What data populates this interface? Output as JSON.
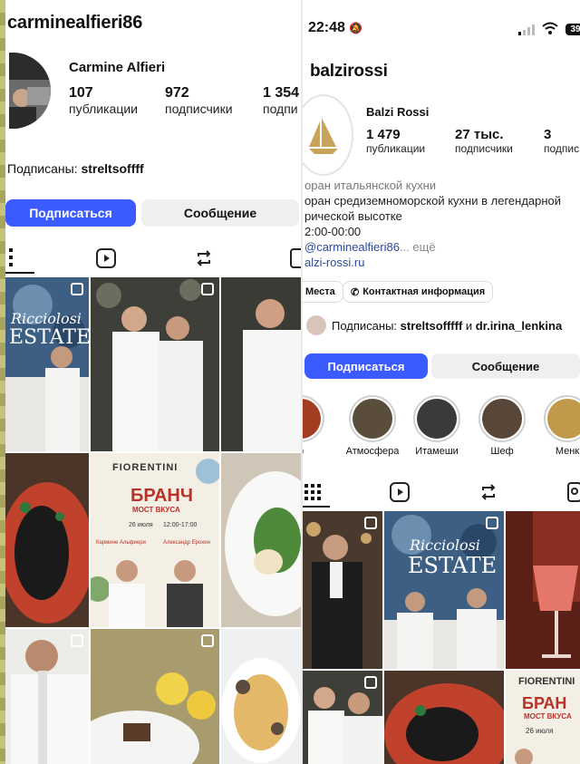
{
  "left": {
    "username": "carminealfieri86",
    "full_name": "Carmine Alfieri",
    "stats": [
      {
        "num": "107",
        "label": "публикации"
      },
      {
        "num": "972",
        "label": "подписчики"
      },
      {
        "num": "1 354",
        "label": "подпи"
      }
    ],
    "followed_by_prefix": "Подписаны:",
    "followed_by_user": "streltsoffff",
    "follow_btn": "Подписаться",
    "message_btn": "Сообщение",
    "grid_tile_texts": {
      "estate_title": "Ricciolosi",
      "estate_sub": "ESTATE",
      "brand": "FIORENTINI",
      "brunch": "БРАНЧ",
      "brunch_sub": "МОСТ ВКУСА",
      "date": "26 июля",
      "time": "12:00-17:00",
      "chef1": "Кармине Альфиери",
      "chef2": "Александр Ерохин"
    }
  },
  "right": {
    "status_time": "22:48",
    "battery": "39",
    "username": "balzirossi",
    "full_name": "Balzi Rossi",
    "stats": [
      {
        "num": "1 479",
        "label": "публикации"
      },
      {
        "num": "27 тыс.",
        "label": "подписчики"
      },
      {
        "num": "3",
        "label": "подпис"
      }
    ],
    "bio_lines": [
      "оран итальянской кухни",
      "оран средиземноморской кухни в легендарной",
      "рической высотке",
      "2:00-00:00"
    ],
    "mention": "@carminealfieri86",
    "more": "... ещё",
    "website": "alzi-rossi.ru",
    "pill_place": "Места",
    "pill_contact": "Контактная информация",
    "followed_by_prefix": "Подписаны:",
    "followed_by_user1": "streltsofffff",
    "followed_by_and": "и",
    "followed_by_user2": "dr.irina_lenkina",
    "follow_btn": "Подписаться",
    "message_btn": "Сообщение",
    "highlights": [
      "р",
      "Атмосфера",
      "Итамеши",
      "Шеф",
      "Менк"
    ],
    "grid_tile_texts": {
      "estate_title": "Ricciolosi",
      "estate_sub": "ESTATE",
      "brand": "FIORENTINI",
      "brunch": "БРАН",
      "brunch_sub": "МОСТ ВКУСА",
      "date": "26 июля"
    }
  }
}
